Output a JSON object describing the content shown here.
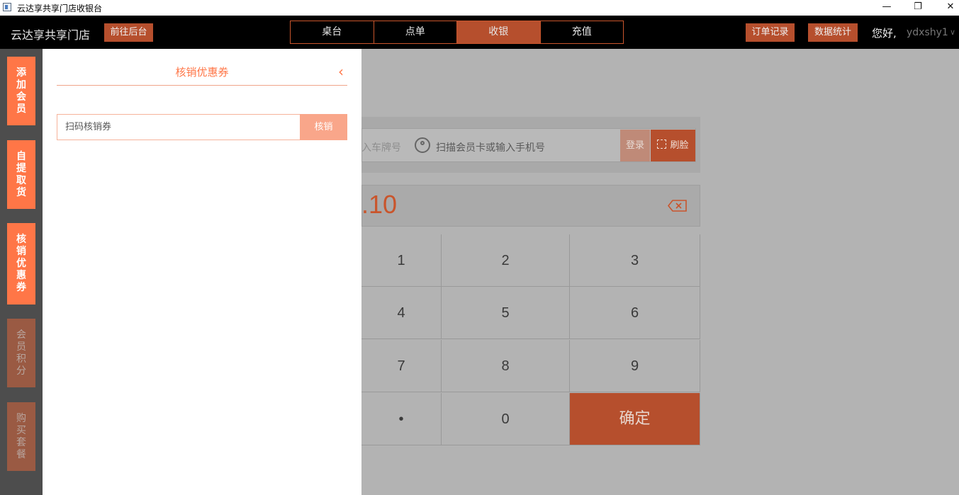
{
  "window": {
    "title": "云达享共享门店收银台",
    "minimize": "—",
    "restore": "❐",
    "close": "✕"
  },
  "header": {
    "brand": "云达享共享门店",
    "backend_button": "前往后台",
    "tabs": [
      "桌台",
      "点单",
      "收银",
      "充值"
    ],
    "active_tab": "收银",
    "order_records": "订单记录",
    "stats": "数据统计",
    "greeting": "您好,",
    "username": "ydxshy1",
    "caret": "∨"
  },
  "sidebar": {
    "items": [
      {
        "label": "添加会员",
        "active": true
      },
      {
        "label": "自提取货",
        "active": true
      },
      {
        "label": "核销优惠券",
        "active": true
      },
      {
        "label": "会员积分",
        "active": false
      },
      {
        "label": "购买套餐",
        "active": false
      }
    ]
  },
  "panel": {
    "title": "核销优惠券",
    "collapse_icon": "‹",
    "input_placeholder": "扫码核销券",
    "verify_button": "核销"
  },
  "cashier": {
    "plate_placeholder": "入车牌号",
    "member_placeholder": "扫描会员卡或输入手机号",
    "login_button": "登录",
    "face_button": "刷脸",
    "amount": ".10",
    "keys": [
      "1",
      "2",
      "3",
      "4",
      "5",
      "6",
      "7",
      "8",
      "9",
      "•",
      "0",
      "确定"
    ]
  },
  "colors": {
    "accent": "#ff7647",
    "dark_accent": "#b64f2d",
    "topbar": "#000000",
    "overlay": "#b3b3b3"
  }
}
